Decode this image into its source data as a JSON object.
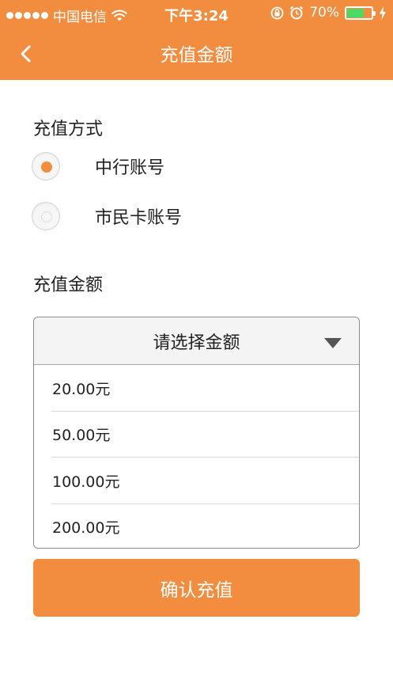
{
  "status_bar": {
    "carrier": "中国电信",
    "time": "下午3:24",
    "battery_percent": "70%",
    "battery_level": 0.7
  },
  "nav": {
    "back_icon": "chevron-left-icon",
    "back_glyph": "<",
    "title": "充值金额"
  },
  "payment_method": {
    "label": "充值方式",
    "options": [
      {
        "label": "中行账号",
        "selected": true
      },
      {
        "label": "市民卡账号",
        "selected": false
      }
    ]
  },
  "amount": {
    "label": "充值金额",
    "placeholder": "请选择金额",
    "options": [
      "20.00元",
      "50.00元",
      "100.00元",
      "200.00元"
    ]
  },
  "confirm_button": {
    "label": "确认充值"
  },
  "colors": {
    "accent": "#f28d3f",
    "battery_fill": "#4cd964"
  }
}
